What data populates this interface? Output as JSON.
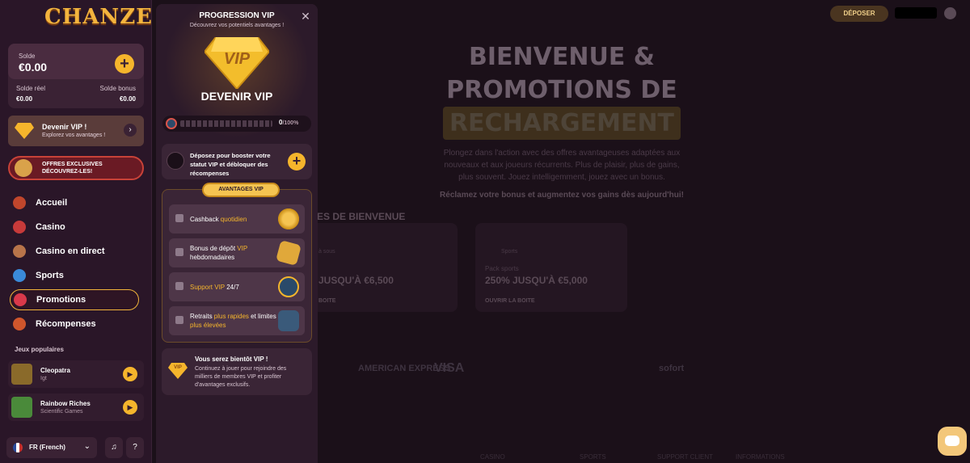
{
  "brand": {
    "logo": "CHANZE"
  },
  "sidebar": {
    "balance": {
      "label": "Solde",
      "value": "€0.00",
      "real_label": "Solde réel",
      "real_value": "€0.00",
      "bonus_label": "Solde bonus",
      "bonus_value": "€0.00"
    },
    "vip_card": {
      "title": "Devenir VIP !",
      "subtitle": "Explorez vos avantages !"
    },
    "offers_banner": {
      "line1": "OFFRES EXCLUSIVES",
      "line2": "DÉCOUVREZ-LES!"
    },
    "nav": [
      {
        "label": "Accueil"
      },
      {
        "label": "Casino"
      },
      {
        "label": "Casino en direct"
      },
      {
        "label": "Sports"
      },
      {
        "label": "Promotions"
      },
      {
        "label": "Récompenses"
      }
    ],
    "popular_heading": "Jeux populaires",
    "games": [
      {
        "title": "Cleopatra",
        "provider": "Igt"
      },
      {
        "title": "Rainbow Riches",
        "provider": "Scientific Games"
      }
    ],
    "language": "FR (French)"
  },
  "header": {
    "deposit_label": "DÉPOSER"
  },
  "hero": {
    "title_line1": "BIENVENUE &",
    "title_line2": "PROMOTIONS DE",
    "title_line3": "RECHARGEMENT",
    "description": "Plongez dans l'action avec des offres avantageuses adaptées aux nouveaux et aux joueurs récurrents. Plus de plaisir, plus de gains, plus souvent. Jouez intelligemment, jouez avec un bonus.",
    "claim": "Réclamez votre bonus et augmentez vos gains dès aujourd'hui!",
    "section_title": "ES DE BIENVENUE"
  },
  "promo_cards": [
    {
      "tag": "à sous",
      "amount": "JUSQU'À €6,500",
      "button": "BOITE"
    },
    {
      "tag": "Sports",
      "subtitle": "Pack sports",
      "amount": "250% JUSQU'À €5,000",
      "button": "OUVRIR LA BOITE"
    }
  ],
  "payments": [
    "AMERICAN EXPRESS",
    "VISA",
    "sofort"
  ],
  "footer_cols": [
    "CASINO",
    "SPORTS",
    "SUPPORT CLIENT",
    "INFORMATIONS"
  ],
  "vip_panel": {
    "title": "PROGRESSION VIP",
    "subtitle": "Découvrez vos potentiels avantages !",
    "badge": "VIP",
    "heading": "DEVENIR VIP",
    "progress_value": "0",
    "progress_suffix": "/100%",
    "progress_fraction": 0,
    "deposit_text": "Déposez pour booster votre statut VIP et débloquer des récompenses",
    "advantages_title": "AVANTAGES VIP",
    "benefits": [
      {
        "pre": "Cashback ",
        "hl": "quotidien",
        "post": ""
      },
      {
        "pre": "Bonus de dépôt ",
        "hl": "VIP",
        "post": " hebdomadaires"
      },
      {
        "pre": "",
        "hl": "Support VIP",
        "post": " 24/7"
      },
      {
        "pre": "Retraits ",
        "hl": "plus rapides",
        "post": " et limites ",
        "hl2": "plus élevées"
      }
    ],
    "soon_title": "Vous serez bientôt VIP !",
    "soon_desc": "Continuez à jouer pour rejoindre des milliers de membres VIP et profiter d'avantages exclusifs.",
    "soon_badge": "VIP"
  }
}
